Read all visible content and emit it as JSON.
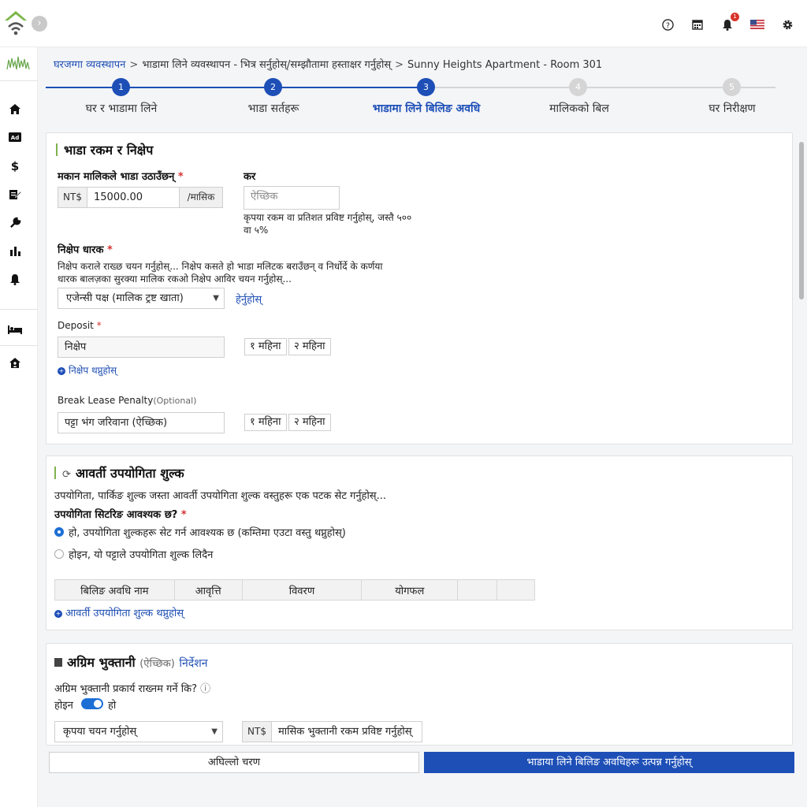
{
  "topbar": {
    "icons": [
      "help-icon",
      "calendar-icon",
      "bell-icon",
      "us-flag-icon",
      "gear-icon"
    ],
    "notification_count": "1"
  },
  "sidebar": {
    "items": [
      "home-icon",
      "ad-icon",
      "dollar-icon",
      "contract-edit-icon",
      "wrench-icon",
      "bar-chart-icon",
      "bell-icon",
      "bed-icon",
      "house-person-icon"
    ]
  },
  "breadcrumb": {
    "items": [
      "घरजग्गा व्यवस्थापन",
      "भाडामा लिने व्यवस्थापन - भित्र सर्नुहोस्/सम्झौतामा हस्ताक्षर गर्नुहोस्",
      "Sunny Heights Apartment - Room 301"
    ]
  },
  "stepper": {
    "steps": [
      {
        "num": "1",
        "label": "घर र भाडामा लिने"
      },
      {
        "num": "2",
        "label": "भाडा सर्तहरू"
      },
      {
        "num": "3",
        "label": "भाडामा लिने बिलिङ अवधि"
      },
      {
        "num": "4",
        "label": "मालिकको बिल"
      },
      {
        "num": "5",
        "label": "घर निरीक्षण"
      }
    ],
    "current": 3
  },
  "rent_card": {
    "title": "भाडा रकम र निक्षेप",
    "rent_label": "मकान मालिकले भाडा उठाउँछन्",
    "currency": "NT$",
    "rent_value": "15000.00",
    "rent_period": "/मासिक",
    "tax_label": "कर",
    "tax_placeholder": "ऐच्छिक",
    "tax_hint_1": "कृपया रकम वा प्रतिशत प्रविष्ट गर्नुहोस्, जस्तै ५००",
    "tax_hint_2": "वा ५%",
    "holder_label": "निक्षेप धारक",
    "holder_desc_1": "निक्षेप कराले राख्छ चयन गर्नुहोस्... निक्षेप कसते हो भाडा मलिटक बराउँछन् व निर्धोर्दे के कर्णया",
    "holder_desc_2": "धारक बालज़का सुरक्या मालिक रकओ निक्षेप आविर चयन गर्नुहोस्...",
    "holder_select": "एजेन्सी पक्ष (मालिक ट्रष्ट खाता)",
    "holder_link": "हेर्नुहोस्",
    "deposit_label": "Deposit",
    "deposit_value": "निक्षेप",
    "chip_1": "१ महिना",
    "chip_2": "२ महिना",
    "add_deposit": "निक्षेप थप्नुहोस्",
    "penalty_label": "Break Lease Penalty",
    "penalty_optional": "(Optional)",
    "penalty_value": "पट्टा भंग जरिवाना (ऐच्छिक)"
  },
  "utility_card": {
    "title": "आवर्ती उपयोगिता शुल्क",
    "desc": "उपयोगिता, पार्किङ शुल्क जस्ता आवर्ती उपयोगिता शुल्क वस्तुहरू एक पटक सेट गर्नुहोस्...",
    "question": "उपयोगिता सिटरिङ आवश्यक छ?",
    "option_yes": "हो, उपयोगिता शुल्कहरू सेट गर्न आवश्यक छ (कम्तिमा एउटा वस्तु थप्नुहोस्)",
    "option_no": "होइन, यो पट्टाले उपयोगिता शुल्क लिदैन",
    "table_headers": [
      "बिलिङ अवधि नाम",
      "आवृत्ति",
      "विवरण",
      "योगफल",
      "",
      ""
    ],
    "add_link": "आवर्ती उपयोगिता शुल्क थप्नुहोस्"
  },
  "advance_card": {
    "title": "अग्रिम भुक्तानी",
    "optional": "(ऐच्छिक)",
    "guide": "निर्देशन",
    "question": "अग्रिम भुक्तानी प्रकार्य राख्नम गर्ने कि?",
    "toggle_off": "होइन",
    "toggle_on": "हो",
    "select_placeholder": "कृपया चयन गर्नुहोस्",
    "currency": "NT$",
    "amount_placeholder": "मासिक भुक्तानी रकम प्रविष्ट गर्नुहोस्"
  },
  "footer": {
    "back": "अघिल्लो चरण",
    "next": "भाडाया लिने बिलिङ अवधिहरू उत्पन्न गर्नुहोस्"
  }
}
